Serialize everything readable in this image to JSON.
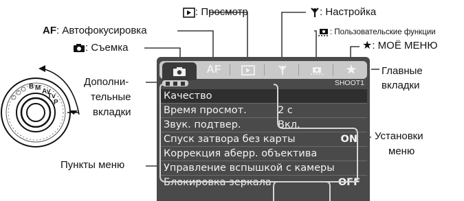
{
  "callouts": {
    "playback": ": Просмотр",
    "setup": ": Настройка",
    "af_prefix": "AF",
    "af": ": Автофокусировка",
    "custom": ": Пользовательские функции",
    "shooting": ": Съемка",
    "mymenu": ": МОЁ МЕНЮ",
    "main_tabs_line1": "Главные",
    "main_tabs_line2": "вкладки",
    "sub_tabs_line1": "Дополни-",
    "sub_tabs_line2": "тельные",
    "sub_tabs_line3": "вкладки",
    "menu_items": "Пункты меню",
    "settings_line1": "Установки",
    "settings_line2": "меню"
  },
  "menu": {
    "tabs": [
      {
        "icon": "camera-icon",
        "label": ""
      },
      {
        "icon": "af-icon",
        "label": "AF"
      },
      {
        "icon": "playback-icon",
        "label": ""
      },
      {
        "icon": "wrench-icon",
        "label": ""
      },
      {
        "icon": "custom-functions-icon",
        "label": ""
      },
      {
        "icon": "star-icon",
        "label": ""
      }
    ],
    "page_label": "SHOOT1",
    "items": [
      {
        "label": "Качество",
        "value": ""
      },
      {
        "label": "Время просмот.",
        "value": "2 с"
      },
      {
        "label": "Звук. подтвер.",
        "value": "Вкл."
      },
      {
        "label": "Спуск затвора без карты",
        "value": "ON"
      },
      {
        "label": "Коррекция аберр. объектива",
        "value": ""
      },
      {
        "label": "Управление вспышкой с камеры",
        "value": ""
      },
      {
        "label": "Блокировка зеркала",
        "value": "OFF"
      }
    ]
  },
  "dial": {
    "labels": [
      "B",
      "M",
      "Av",
      "Tv",
      "P"
    ]
  },
  "colors": {
    "menu_bg": "#4a4a4a",
    "tabbar_bg": "#c9c9c9",
    "bracket": "#d6d6d6"
  }
}
